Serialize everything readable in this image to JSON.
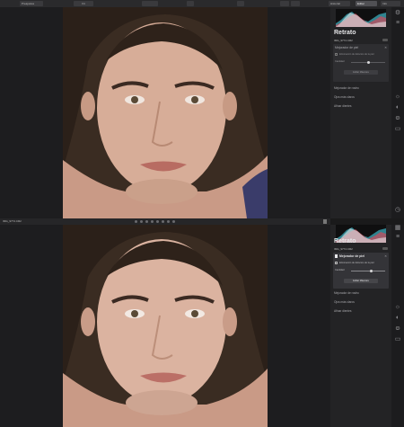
{
  "toolbar": {
    "left_label": "Preajustes",
    "zoom_label": "Fit",
    "right_labels": [
      "Historial",
      "Editar",
      "Info"
    ]
  },
  "file_name": "IMG_9774.CR2",
  "top_panel": {
    "title": "Retrato",
    "file_name": "IMG_9774.CR2",
    "card_title": "Mejorador de piel",
    "card_option": "Eliminación de defectos de la piel",
    "slider_label": "Cantidad",
    "slider_value": 0.5,
    "button_label": "Editar Máscara",
    "sections": [
      "Mejorador de rostro",
      "Ojos más claros",
      "Afinar dientes"
    ]
  },
  "bottom_panel": {
    "title": "Retrato",
    "file_name": "IMG_9774.CR2",
    "card_title": "Mejorador de piel",
    "card_option": "Eliminación de defectos de la piel",
    "slider_label": "Cantidad",
    "slider_value": 0.6,
    "button_label": "Editar Máscara",
    "sections": [
      "Mejorador de rostro",
      "Ojos más claros",
      "Afinar dientes"
    ]
  },
  "icons": {
    "rail_top": [
      "gear-icon",
      "layers-icon",
      "sun-icon",
      "palette-icon",
      "face-icon",
      "crop-icon",
      "clock-icon",
      "grid-icon",
      "sliders-icon"
    ],
    "rail_bottom": [
      "sun-icon",
      "palette-icon",
      "face-icon",
      "crop-icon"
    ]
  },
  "colors": {
    "background": "#1a1a1b",
    "panel": "#232325",
    "accent": "#e6e6e8"
  }
}
